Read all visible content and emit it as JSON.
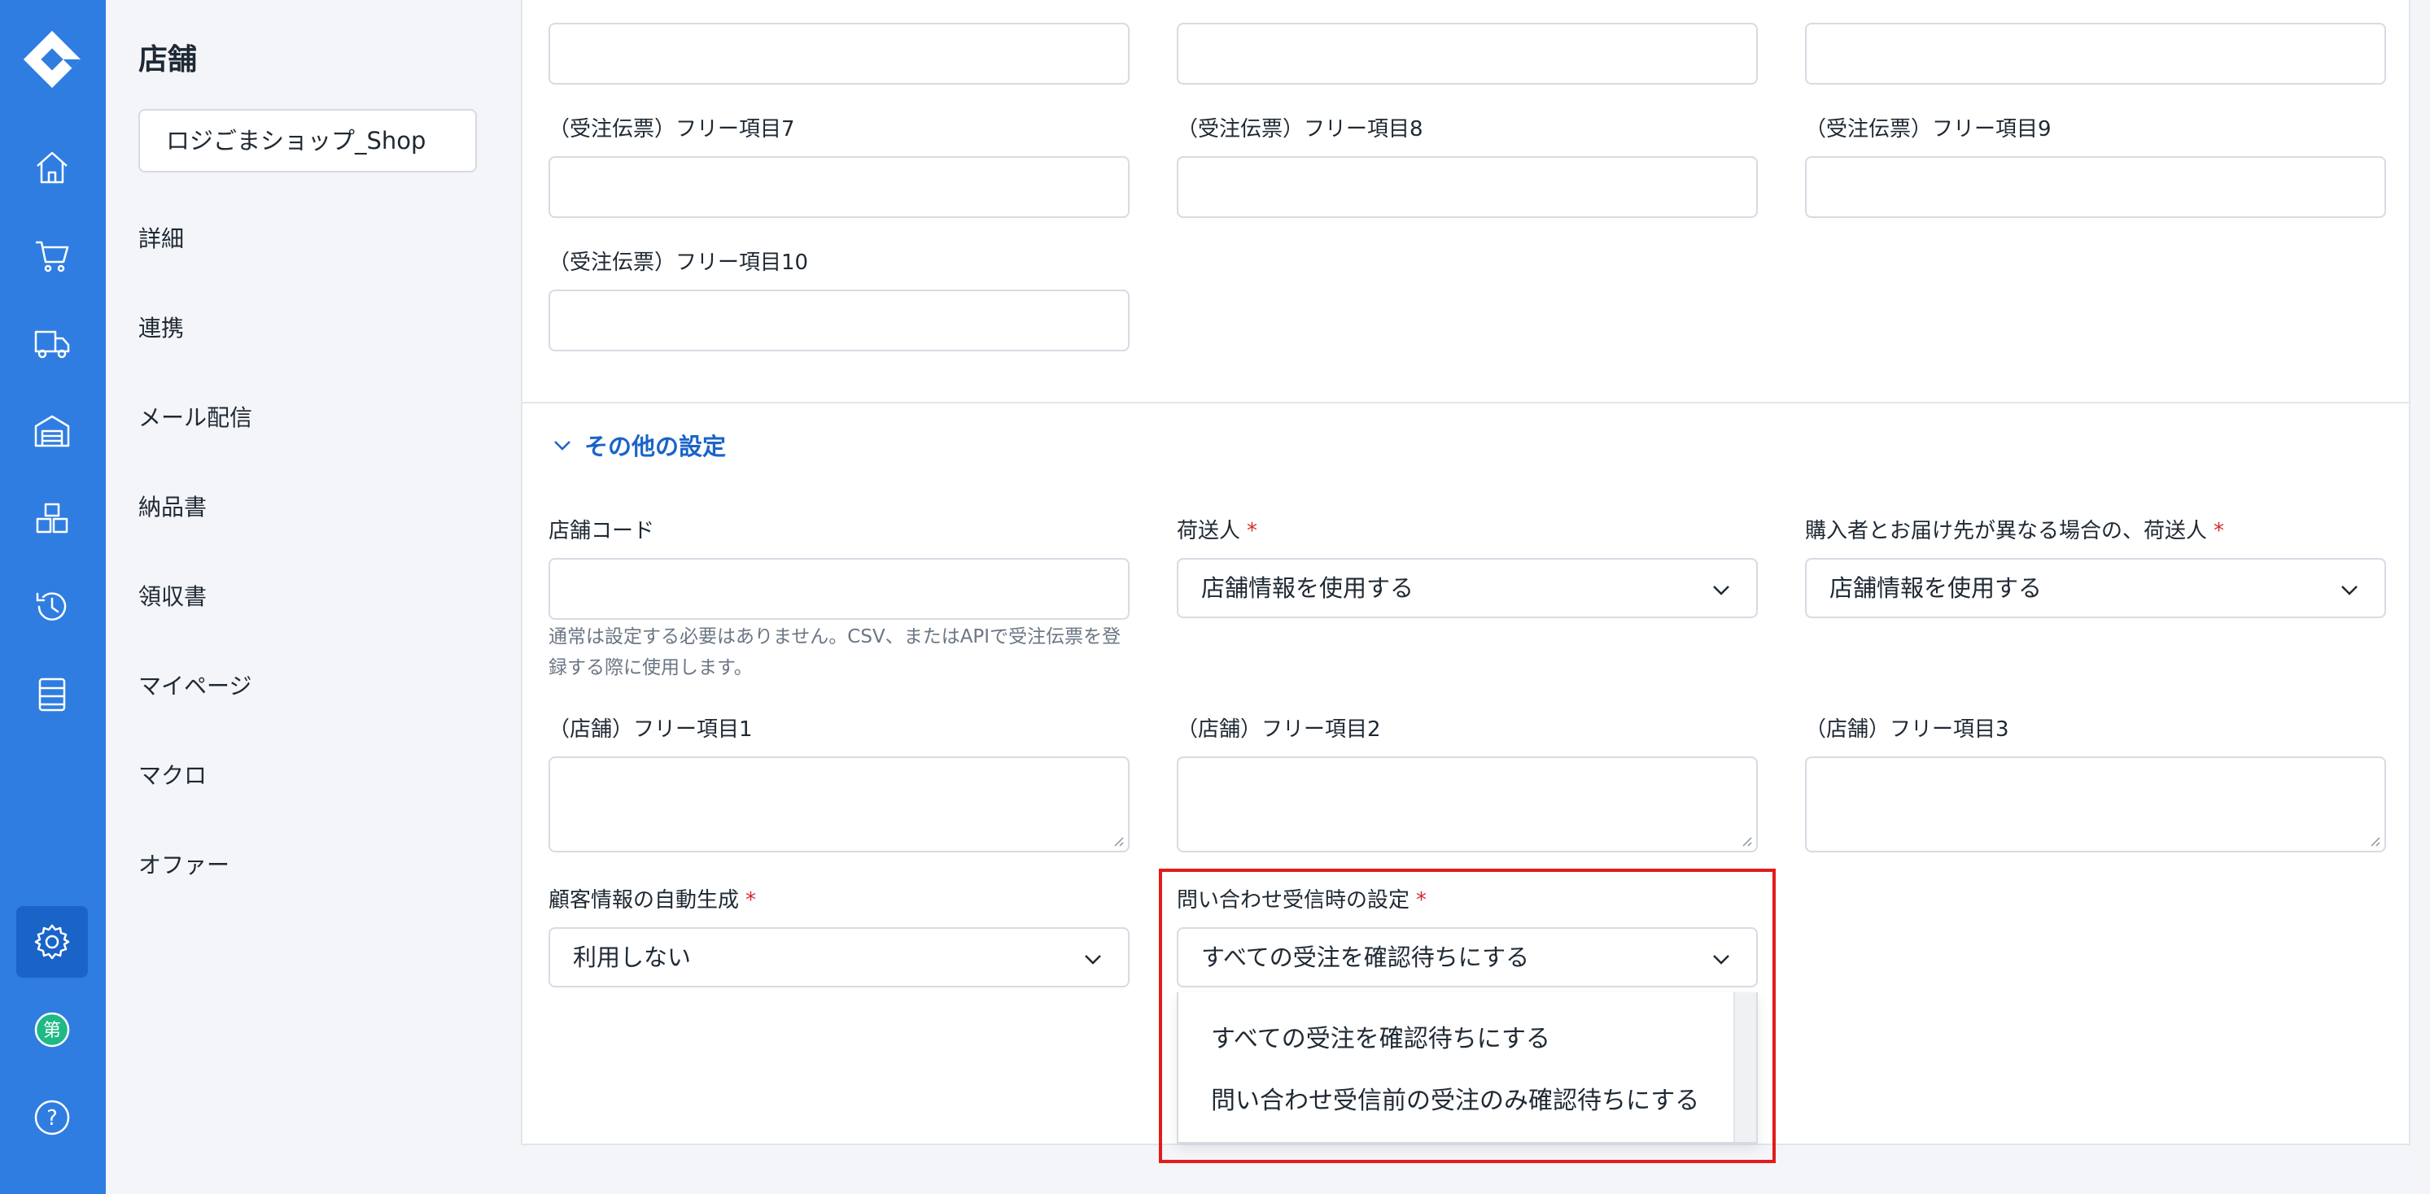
{
  "icons": {
    "logo": "logo-icon",
    "rail": [
      "home-icon",
      "cart-icon",
      "truck-icon",
      "warehouse-icon",
      "boxes-icon",
      "history-icon",
      "document-list-icon",
      "gear-icon",
      "account-badge-icon",
      "help-icon"
    ]
  },
  "colors": {
    "rail_bg": "#2f7de1",
    "rail_active": "#1a64c8",
    "accent": "#1a64c8",
    "required": "#d52b2b",
    "highlight": "#e31b1b"
  },
  "account_badge": "第",
  "help_glyph": "?",
  "subnav": {
    "title": "店舗",
    "shop_selector": "ロジごまショップ_Shop",
    "items": [
      "詳細",
      "連携",
      "メール配信",
      "納品書",
      "領収書",
      "マイページ",
      "マクロ",
      "オファー"
    ]
  },
  "order_free_fields": {
    "labels": [
      "（受注伝票）フリー項目7",
      "（受注伝票）フリー項目8",
      "（受注伝票）フリー項目9",
      "（受注伝票）フリー項目10"
    ]
  },
  "other_settings": {
    "section_title": "その他の設定",
    "store_code": {
      "label": "店舗コード",
      "value": "",
      "help": "通常は設定する必要はありません。CSV、またはAPIで受注伝票を登録する際に使用します。"
    },
    "shipper": {
      "label": "荷送人",
      "required_mark": "*",
      "value": "店舗情報を使用する"
    },
    "shipper_alt": {
      "label": "購入者とお届け先が異なる場合の、荷送人",
      "required_mark": "*",
      "value": "店舗情報を使用する"
    },
    "store_free_fields": {
      "labels": [
        "（店舗）フリー項目1",
        "（店舗）フリー項目2",
        "（店舗）フリー項目3"
      ]
    },
    "auto_customer": {
      "label": "顧客情報の自動生成",
      "required_mark": "*",
      "value": "利用しない"
    },
    "inquiry": {
      "label": "問い合わせ受信時の設定",
      "required_mark": "*",
      "value": "すべての受注を確認待ちにする",
      "options": [
        "すべての受注を確認待ちにする",
        "問い合わせ受信前の受注のみ確認待ちにする"
      ]
    }
  }
}
